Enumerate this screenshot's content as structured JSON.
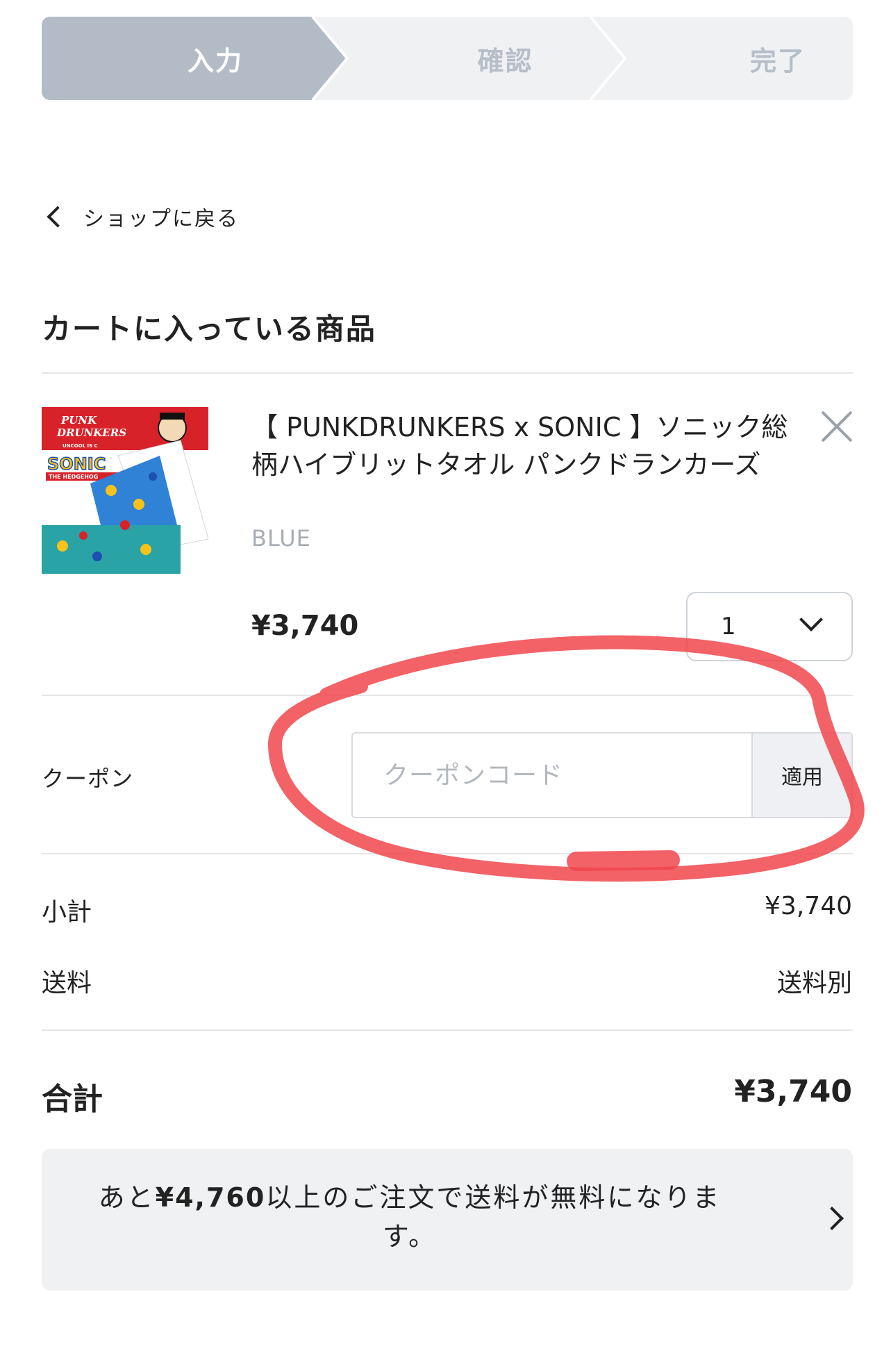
{
  "stepper": {
    "steps": [
      {
        "label": "入力",
        "active": true
      },
      {
        "label": "確認",
        "active": false
      },
      {
        "label": "完了",
        "active": false
      }
    ],
    "active_color": "#b3bcc6",
    "inactive_color": "#f0f1f3"
  },
  "back_link": {
    "label": "ショップに戻る"
  },
  "cart": {
    "title": "カートに入っている商品",
    "item": {
      "name": "【 PUNKDRUNKERS x SONIC 】ソニック総柄ハイブリットタオル パンクドランカーズ",
      "variant": "BLUE",
      "price": "¥3,740",
      "quantity": "1",
      "image_text": {
        "brand": "PUNK DRUNKERS",
        "tagline": "UNCOOL IS C",
        "logo": "SONIC",
        "logo_sub": "THE HEDGEHOG"
      }
    }
  },
  "coupon": {
    "label": "クーポン",
    "placeholder": "クーポンコード",
    "value": "",
    "apply_label": "適用"
  },
  "summary": {
    "subtotal_label": "小計",
    "subtotal_value": "¥3,740",
    "shipping_label": "送料",
    "shipping_value": "送料別",
    "total_label": "合計",
    "total_value": "¥3,740"
  },
  "free_shipping_banner": {
    "prefix": "あと",
    "amount": "¥4,760",
    "suffix": "以上のご注文で送料が無料になります。"
  },
  "annotation": {
    "color": "#f0474c"
  }
}
